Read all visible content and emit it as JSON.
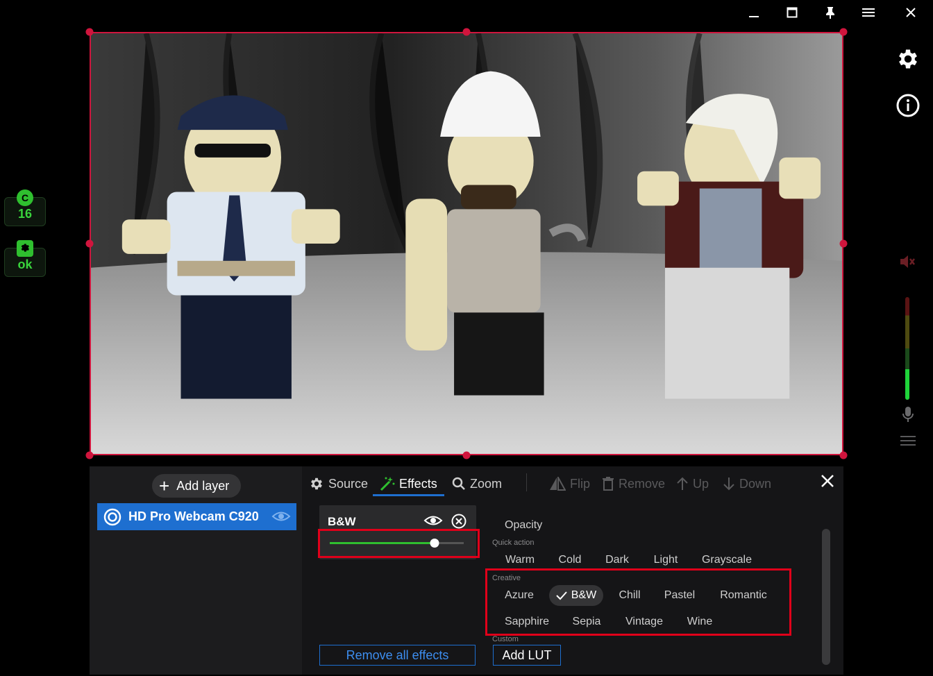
{
  "window": {
    "controls": [
      "minimize-icon",
      "maximize-icon",
      "pin-icon",
      "menu-icon",
      "close-icon"
    ]
  },
  "status": {
    "cpu_badge_letter": "C",
    "cpu_badge_value": "16",
    "status_badge_value": "ok"
  },
  "audio": {
    "level_fraction": 0.3
  },
  "layers": {
    "add_label": "Add layer",
    "items": [
      {
        "label": "HD Pro Webcam C920",
        "visible": true
      }
    ]
  },
  "toolbar": {
    "source": "Source",
    "effects": "Effects",
    "zoom": "Zoom",
    "flip": "Flip",
    "remove": "Remove",
    "up": "Up",
    "down": "Down"
  },
  "effect_card": {
    "title": "B&W",
    "intensity_fraction": 0.78
  },
  "filters": {
    "opacity_label": "Opacity",
    "quick_action_label": "Quick action",
    "quick_action": [
      "Warm",
      "Cold",
      "Dark",
      "Light",
      "Grayscale"
    ],
    "creative_label": "Creative",
    "creative_row1": [
      "Azure",
      "B&W",
      "Chill",
      "Pastel",
      "Romantic"
    ],
    "creative_row2": [
      "Sapphire",
      "Sepia",
      "Vintage",
      "Wine"
    ],
    "selected": "B&W",
    "custom_label": "Custom",
    "add_lut": "Add LUT",
    "remove_all": "Remove all effects"
  },
  "colors": {
    "accent": "#1e6fd0",
    "selection_frame": "#d0153d",
    "highlight": "#e0001a",
    "status_green": "#39d43c"
  }
}
